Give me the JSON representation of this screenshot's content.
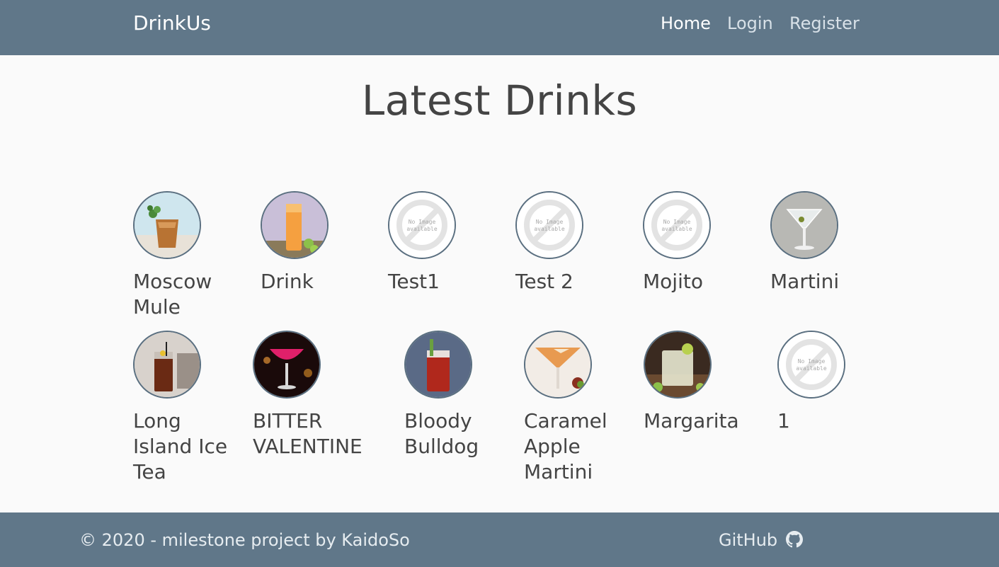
{
  "nav": {
    "brand": "DrinkUs",
    "links": [
      {
        "label": "Home",
        "active": true
      },
      {
        "label": "Login",
        "active": false
      },
      {
        "label": "Register",
        "active": false
      }
    ]
  },
  "main": {
    "title": "Latest Drinks",
    "no_image_text": [
      "No Image",
      "available"
    ],
    "drinks": [
      {
        "name": "Moscow Mule",
        "image": "copper-mug-photo"
      },
      {
        "name": "Drink",
        "image": "orange-cocktail-photo"
      },
      {
        "name": "Test1",
        "image": "no-image"
      },
      {
        "name": "Test 2",
        "image": "no-image"
      },
      {
        "name": "Mojito",
        "image": "no-image"
      },
      {
        "name": "Martini",
        "image": "martini-glass-photo"
      },
      {
        "name": "Long Island Ice Tea",
        "image": "iced-tea-photo"
      },
      {
        "name": "BITTER VALENTINE",
        "image": "pink-coupe-photo"
      },
      {
        "name": "Bloody Bulldog",
        "image": "red-highball-photo"
      },
      {
        "name": "Caramel Apple Martini",
        "image": "caramel-martini-photo"
      },
      {
        "name": "Margarita",
        "image": "margarita-photo"
      },
      {
        "name": "1",
        "image": "no-image"
      }
    ]
  },
  "footer": {
    "copyright": "© 2020 - milestone project by KaidoSo",
    "github_label": "GitHub",
    "github_icon": "github-icon"
  },
  "colors": {
    "navbar": "#607789",
    "background": "#fafafa",
    "text": "#444444"
  }
}
